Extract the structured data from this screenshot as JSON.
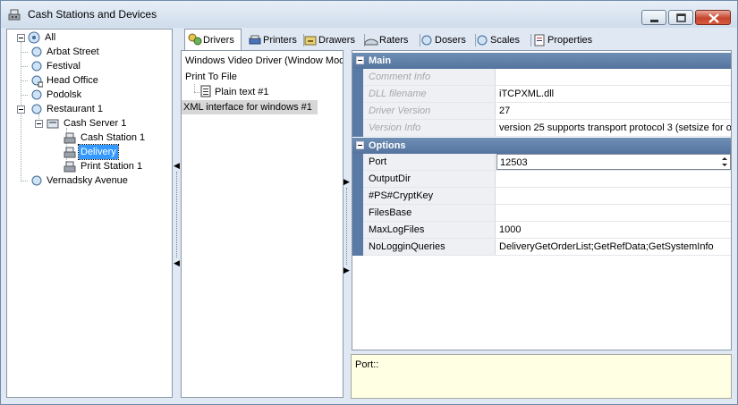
{
  "window": {
    "title": "Cash Stations and Devices"
  },
  "tree": {
    "root": "All",
    "items": [
      "Arbat Street",
      "Festival",
      "Head Office",
      "Podolsk",
      "Restaurant 1",
      "Cash Server 1",
      "Cash Station 1",
      "Delivery",
      "Print Station 1",
      "Vernadsky Avenue"
    ]
  },
  "tabs": [
    "Drivers",
    "Printers",
    "Drawers",
    "Raters",
    "Dosers",
    "Scales",
    "Properties"
  ],
  "drivers": {
    "items": [
      "Windows Video Driver (Window Mod",
      "Print To File",
      "Plain text #1",
      "XML interface for windows #1"
    ]
  },
  "props": {
    "main_label": "Main",
    "options_label": "Options",
    "main_rows": [
      {
        "name": "Comment Info",
        "value": ""
      },
      {
        "name": "DLL filename",
        "value": "iTCPXML.dll"
      },
      {
        "name": "Driver Version",
        "value": "27"
      },
      {
        "name": "Version Info",
        "value": "version 25 supports transport protocol 3 (setsize for out"
      }
    ],
    "option_rows": [
      {
        "name": "Port",
        "value": "12503"
      },
      {
        "name": "OutputDir",
        "value": ""
      },
      {
        "name": "#PS#CryptKey",
        "value": ""
      },
      {
        "name": "FilesBase",
        "value": ""
      },
      {
        "name": "MaxLogFiles",
        "value": "1000"
      },
      {
        "name": "NoLogginQueries",
        "value": "DeliveryGetOrderList;GetRefData;GetSystemInfo"
      }
    ]
  },
  "description": "Port::",
  "colors": {
    "selection": "#3399ff",
    "group_header": "#5f80ab",
    "description_bg": "#ffffe3"
  }
}
